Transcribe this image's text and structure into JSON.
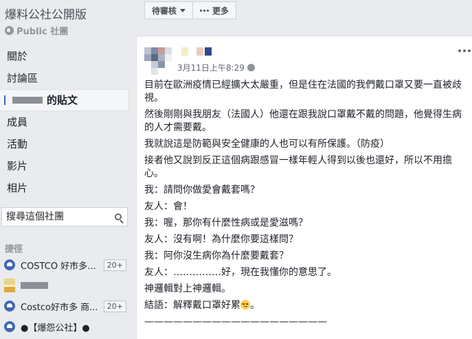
{
  "group": {
    "title": "爆料公社公開版",
    "privacy": "Public 社團"
  },
  "nav": {
    "items": [
      {
        "label": "關於"
      },
      {
        "label": "討論區"
      },
      {
        "label": "的貼文"
      },
      {
        "label": "成員"
      },
      {
        "label": "活動"
      },
      {
        "label": "影片"
      },
      {
        "label": "相片"
      }
    ]
  },
  "search": {
    "placeholder": "搜尋這個社團"
  },
  "shortcuts": {
    "title": "捷徑",
    "items": [
      {
        "name": "COSTCO 好市多...",
        "badge": "20+"
      },
      {
        "name": "",
        "badge": ""
      },
      {
        "name": "Costco好市多 商...",
        "badge": "20+"
      },
      {
        "name": "●【爆怨公社】●",
        "badge": ""
      }
    ]
  },
  "toolbar": {
    "pending_label": "待審核",
    "more_label": "更多"
  },
  "post": {
    "timestamp": "3月11日上午8:29",
    "paragraphs": [
      "目前在歐洲疫情已經擴大太嚴重，但是住在法國的我們戴口罩又要一直被歧視。",
      "然後剛剛與我朋友（法國人）他還在跟我說口罩戴不戴的問題，他覺得生病的人才需要戴。",
      "我就說這是防範與安全健康的人也可以有所保護。（防疫）",
      "接者他又說到反正這個病跟感冒一樣年輕人得到以後也還好，所以不用擔心。",
      "我：請問你做愛會戴套嗎？",
      "友人：會！",
      "我：喔，那你有什麼性病或是愛滋嗎？",
      "友人：沒有啊！為什麼你要這樣問？",
      "我：阿你沒生病你為什麼要戴套？",
      "友人：……………好，現在我懂你的意思了。",
      "神邏輯對上神邏輯。",
      "結語：解釋戴口罩好累"
    ],
    "divider": "———————————————————"
  },
  "colors": {
    "accent": "#4267b2",
    "background": "#e9ebee"
  }
}
